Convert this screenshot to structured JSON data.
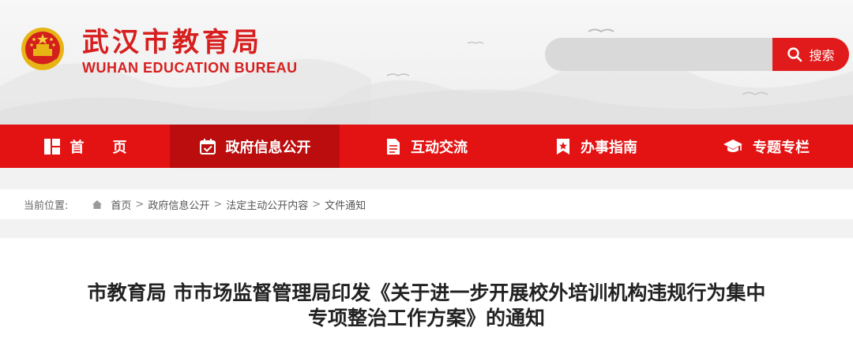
{
  "header": {
    "title_cn": "武汉市教育局",
    "title_en": "WUHAN EDUCATION BUREAU"
  },
  "search": {
    "placeholder": "",
    "button_label": "搜索"
  },
  "nav": {
    "items": [
      {
        "label": "首　　页",
        "icon": "home-grid-icon"
      },
      {
        "label": "政府信息公开",
        "icon": "calendar-check-icon"
      },
      {
        "label": "互动交流",
        "icon": "document-icon"
      },
      {
        "label": "办事指南",
        "icon": "bookmark-star-icon"
      },
      {
        "label": "专题专栏",
        "icon": "graduation-cap-icon"
      }
    ],
    "active_index": 1
  },
  "breadcrumb": {
    "label": "当前位置:",
    "items": [
      "首页",
      "政府信息公开",
      "法定主动公开内容",
      "文件通知"
    ],
    "separator": ">"
  },
  "article": {
    "title_line1": "市教育局 市市场监督管理局印发《关于进一步开展校外培训机构违规行为集中",
    "title_line2": "专项整治工作方案》的通知"
  },
  "colors": {
    "brand_red": "#d71f1f",
    "nav_red": "#e41313",
    "nav_active": "#bb0d0d"
  }
}
